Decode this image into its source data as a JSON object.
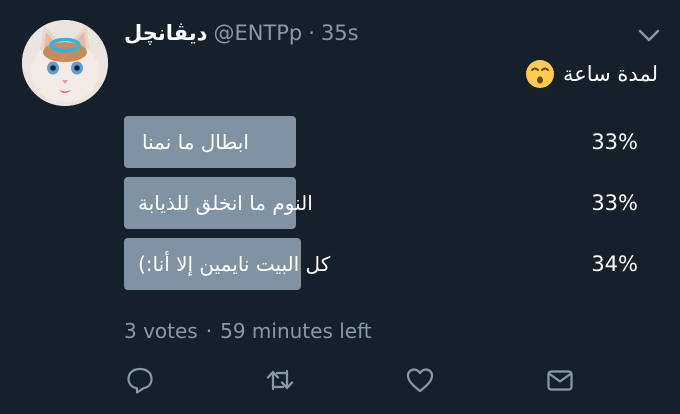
{
  "tweet": {
    "display_name": "ديڤانچل",
    "handle": "@ENTPp",
    "separator": "·",
    "time": "35s",
    "text": "لمدة ساعة",
    "emoji": "kissing-face-emoji"
  },
  "poll": {
    "options": [
      {
        "label": "ابطال ما نمنا",
        "percent_text": "33%",
        "percent": 33
      },
      {
        "label": "النوم ما انخلق للذيابة",
        "percent_text": "33%",
        "percent": 33
      },
      {
        "label": "كل البيت نايمين إلا أنا:)",
        "percent_text": "34%",
        "percent": 34
      }
    ],
    "votes": "3 votes",
    "separator": "·",
    "time_left": "59 minutes left"
  },
  "actions": [
    "reply-icon",
    "retweet-icon",
    "like-icon",
    "share-mail-icon"
  ],
  "colors": {
    "background": "#15202b",
    "bar": "#8193a3",
    "secondary_text": "#8899a6"
  }
}
